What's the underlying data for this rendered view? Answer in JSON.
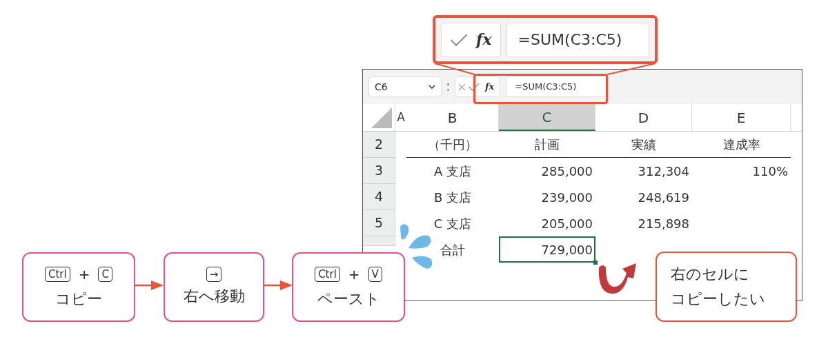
{
  "zoom_callout": {
    "fx_label": "fx",
    "formula": "=SUM(C3:C5)"
  },
  "excel": {
    "name_box": "C6",
    "fx_label": "fx",
    "formula": "=SUM(C3:C5)",
    "columns": [
      {
        "label": "A",
        "selected": false
      },
      {
        "label": "B",
        "selected": false
      },
      {
        "label": "C",
        "selected": true
      },
      {
        "label": "D",
        "selected": false
      },
      {
        "label": "E",
        "selected": false
      }
    ],
    "rows": [
      {
        "number": "2",
        "cells": [
          {
            "selected": false
          },
          {
            "text": "（千円）",
            "selected": false
          },
          {
            "text": "計画",
            "selected": false
          },
          {
            "text": "実績",
            "selected": false
          },
          {
            "text": "達成率",
            "selected": false
          }
        ]
      },
      {
        "number": "3",
        "cells": [
          {
            "selected": false
          },
          {
            "text": "A 支店",
            "selected": false
          },
          {
            "text": "285,000",
            "selected": false
          },
          {
            "text": "312,304",
            "selected": false
          },
          {
            "text": "110%",
            "selected": false
          }
        ]
      },
      {
        "number": "4",
        "cells": [
          {
            "selected": false
          },
          {
            "text": "B 支店",
            "selected": false
          },
          {
            "text": "239,000",
            "selected": false
          },
          {
            "text": "248,619",
            "selected": false
          },
          {
            "selected": false
          }
        ]
      },
      {
        "number": "5",
        "cells": [
          {
            "selected": false
          },
          {
            "text": "C 支店",
            "selected": false
          },
          {
            "text": "205,000",
            "selected": false
          },
          {
            "text": "215,898",
            "selected": false
          },
          {
            "selected": false
          }
        ]
      },
      {
        "cells": [
          {
            "selected": false
          },
          {
            "text": "合計",
            "selected": false
          },
          {
            "text": "729,000",
            "selected": true
          },
          {
            "selected": false
          },
          {
            "selected": false
          }
        ]
      }
    ]
  },
  "steps": [
    {
      "keys": [
        {
          "label": "Ctrl"
        },
        {
          "label": "C"
        }
      ],
      "joiner": "+",
      "label": "コピー"
    },
    {
      "keys": [
        {
          "label": "→"
        }
      ],
      "label": "右へ移動"
    },
    {
      "keys": [
        {
          "label": "Ctrl"
        },
        {
          "label": "V"
        }
      ],
      "joiner": "+",
      "label": "ペースト"
    }
  ],
  "callout": {
    "lines": [
      "右のセルに",
      "コピーしたい"
    ]
  }
}
